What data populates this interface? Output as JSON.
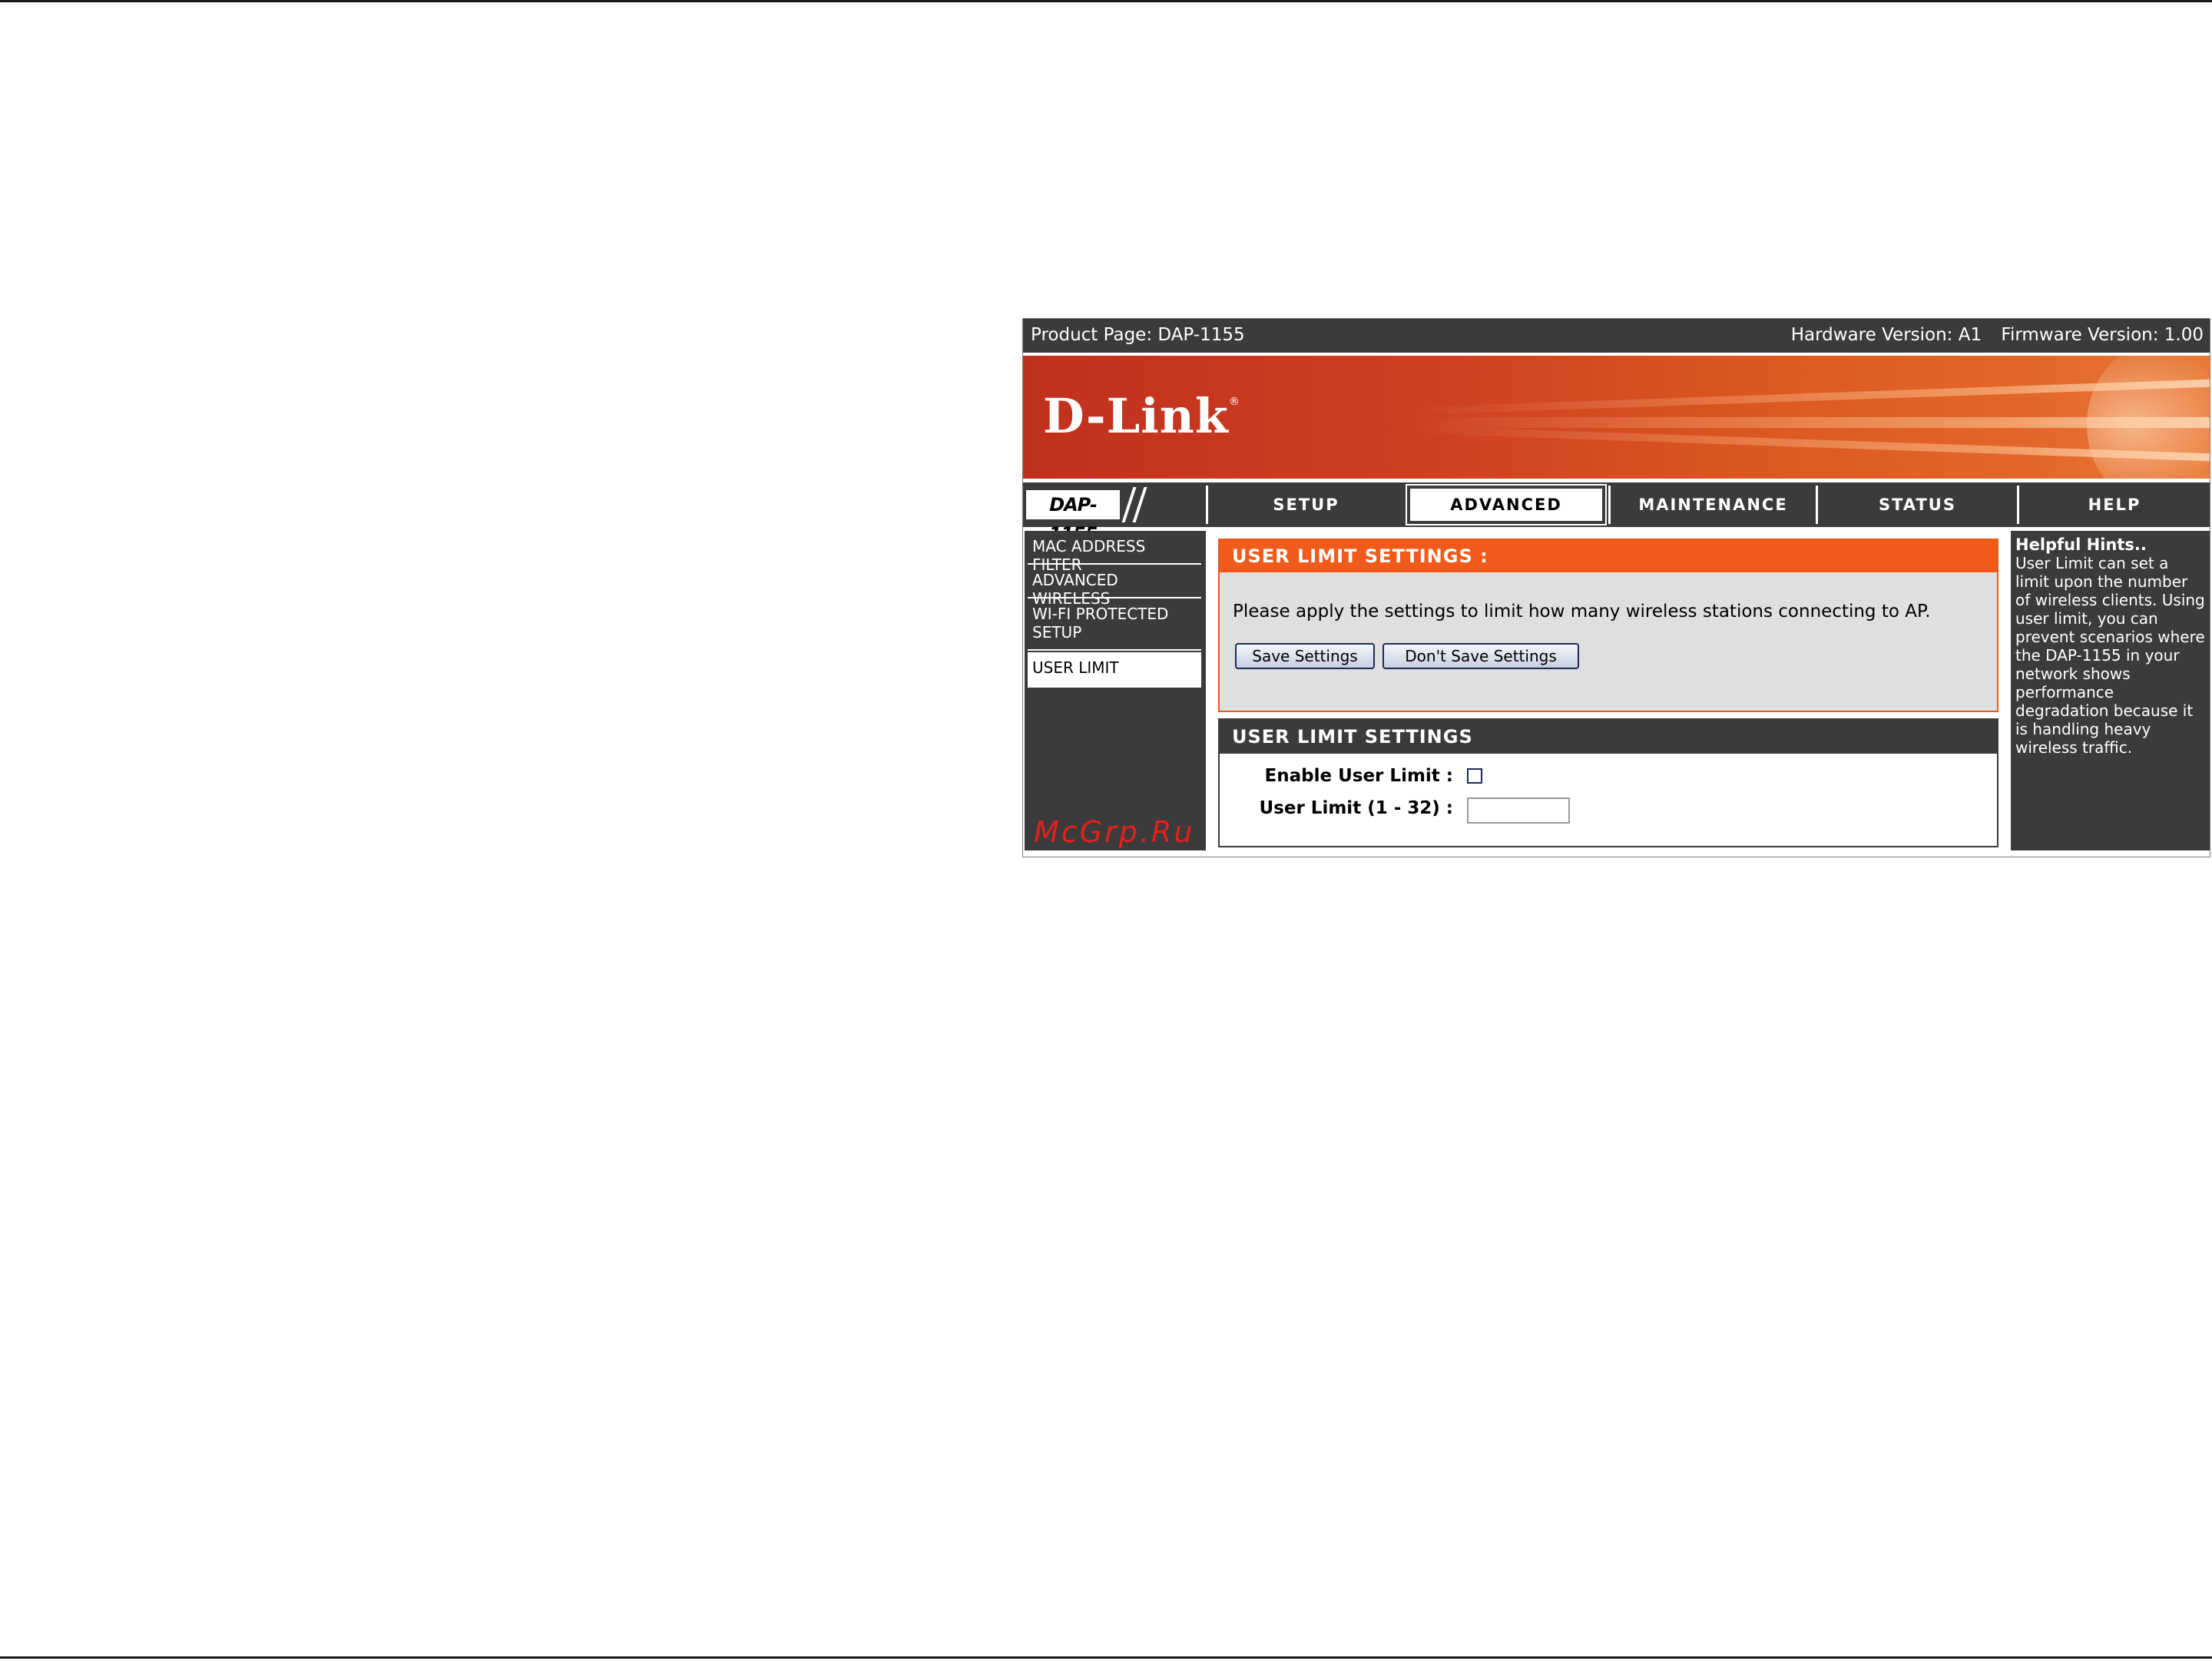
{
  "header": {
    "product_page": "Product Page: DAP-1155",
    "hardware_version": "Hardware Version: A1",
    "firmware_version": "Firmware Version: 1.00"
  },
  "banner": {
    "logo": "D-Link",
    "logo_mark": "®"
  },
  "model": "DAP-1155",
  "nav": {
    "tabs": [
      {
        "label": "SETUP",
        "active": false
      },
      {
        "label": "ADVANCED",
        "active": true
      },
      {
        "label": "MAINTENANCE",
        "active": false
      },
      {
        "label": "STATUS",
        "active": false
      },
      {
        "label": "HELP",
        "active": false
      }
    ]
  },
  "sidebar": {
    "items": [
      {
        "label": "MAC ADDRESS FILTER",
        "active": false
      },
      {
        "label": "ADVANCED WIRELESS",
        "active": false
      },
      {
        "label": "WI-FI PROTECTED SETUP",
        "active": false
      },
      {
        "label": "USER LIMIT",
        "active": true
      }
    ],
    "watermark": "McGrp.Ru"
  },
  "main": {
    "section1": {
      "title": "USER LIMIT SETTINGS :",
      "description": "Please apply the settings to limit how many wireless stations connecting to AP.",
      "save_label": "Save Settings",
      "dont_save_label": "Don't Save Settings"
    },
    "section2": {
      "title": "USER LIMIT SETTINGS",
      "enable_label": "Enable User Limit :",
      "enable_checked": false,
      "limit_label": "User Limit (1 - 32) :",
      "limit_value": ""
    }
  },
  "hints": {
    "title": "Helpful Hints..",
    "body": "User Limit can set a limit upon the number of wireless clients. Using user limit, you can prevent scenarios where the DAP-1155 in your network shows performance degradation because it is handling heavy wireless traffic."
  },
  "colors": {
    "dark_gray": "#3b3b3b",
    "orange_header": "#f05a1a",
    "banner_red": "#c0301e",
    "panel_gray": "#dfdfdf"
  }
}
